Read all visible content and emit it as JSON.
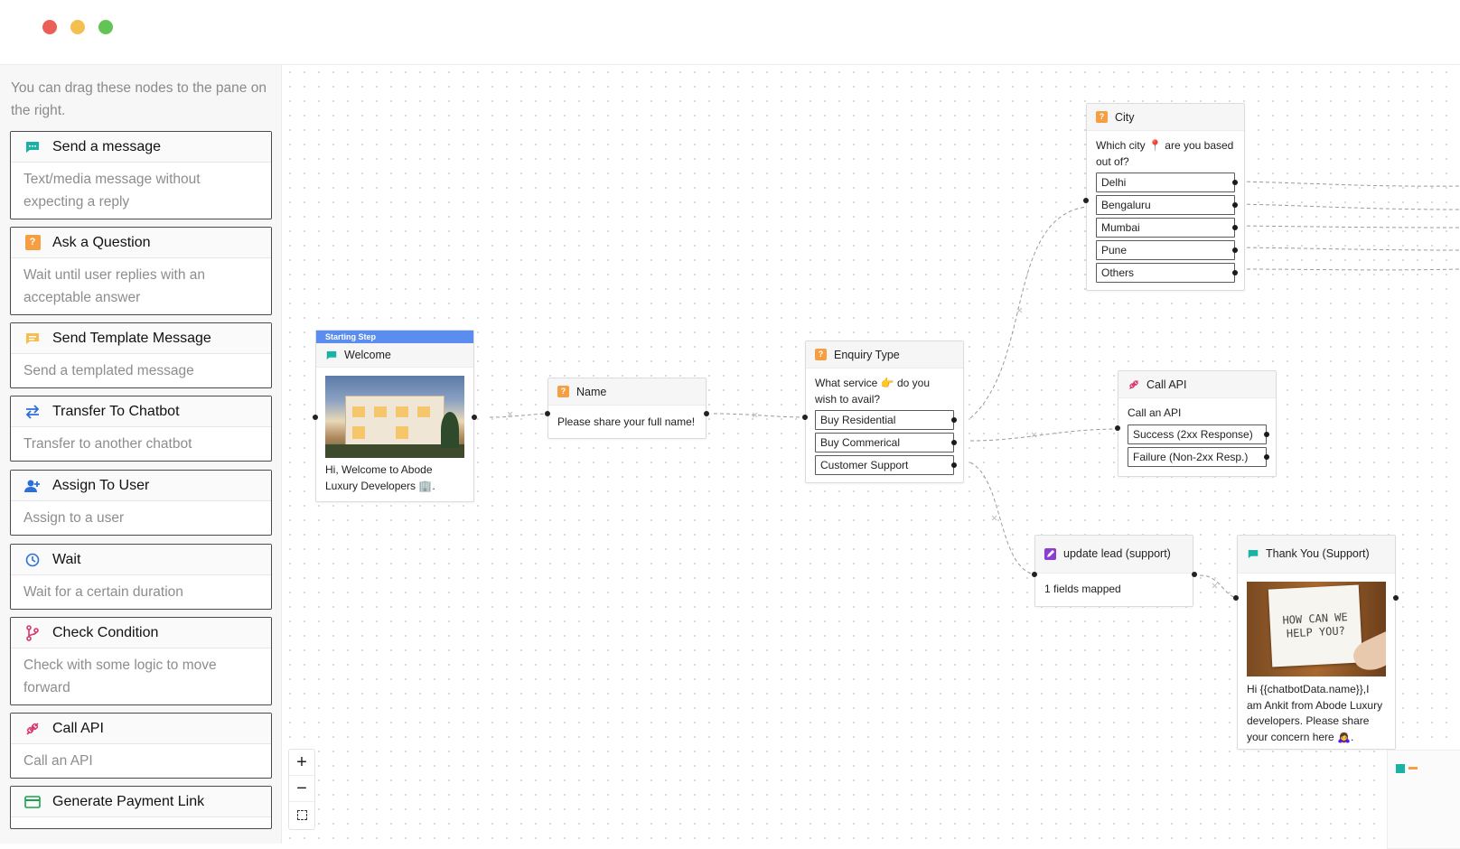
{
  "window": {
    "controls": [
      "close",
      "minimize",
      "maximize"
    ]
  },
  "colors": {
    "red": "#ec5f57",
    "yellow": "#f4bf4f",
    "green": "#62c454",
    "teal": "#19b3a6",
    "orange": "#f59e42",
    "blue": "#5b8def",
    "purple": "#8b3fd1",
    "pink": "#d9386d"
  },
  "sidebar": {
    "hint": "You can drag these nodes to the pane on the right.",
    "items": [
      {
        "title": "Send a message",
        "desc": "Text/media message without expecting a reply",
        "icon": "message-icon"
      },
      {
        "title": "Ask a Question",
        "desc": "Wait until user replies with an acceptable answer",
        "icon": "question-icon"
      },
      {
        "title": "Send Template Message",
        "desc": "Send a templated message",
        "icon": "template-icon"
      },
      {
        "title": "Transfer To Chatbot",
        "desc": "Transfer to another chatbot",
        "icon": "transfer-icon"
      },
      {
        "title": "Assign To User",
        "desc": "Assign to a user",
        "icon": "assign-user-icon"
      },
      {
        "title": "Wait",
        "desc": "Wait for a certain duration",
        "icon": "clock-icon"
      },
      {
        "title": "Check Condition",
        "desc": "Check with some logic to move forward",
        "icon": "branch-icon"
      },
      {
        "title": "Call API",
        "desc": "Call an API",
        "icon": "plug-icon"
      },
      {
        "title": "Generate Payment Link",
        "desc": "",
        "icon": "card-icon"
      }
    ]
  },
  "nodes": {
    "welcome": {
      "badge": "Starting Step",
      "title": "Welcome",
      "text": "Hi, Welcome to Abode Luxury Developers 🏢."
    },
    "name": {
      "title": "Name",
      "text": "Please share your full name!"
    },
    "enquiry": {
      "title": "Enquiry Type",
      "text": "What service 👉 do you wish to avail?",
      "options": [
        "Buy Residential",
        "Buy Commerical",
        "Customer Support"
      ]
    },
    "city": {
      "title": "City",
      "text": "Which city 📍 are you based out of?",
      "options": [
        "Delhi",
        "Bengaluru",
        "Mumbai",
        "Pune",
        "Others"
      ]
    },
    "call_api": {
      "title": "Call API",
      "text": "Call an API",
      "options": [
        "Success (2xx Response)",
        "Failure (Non-2xx Resp.)"
      ]
    },
    "update_lead": {
      "title": "update lead (support)",
      "text": "1 fields mapped"
    },
    "thank_you": {
      "title": "Thank You (Support)",
      "image_text": "HOW CAN WE HELP YOU?",
      "text": "Hi {{chatbotData.name}},I am Ankit from Abode Luxury developers. Please share your concern here 🙇‍♀️."
    }
  },
  "zoom": {
    "in": "+",
    "out": "−"
  }
}
